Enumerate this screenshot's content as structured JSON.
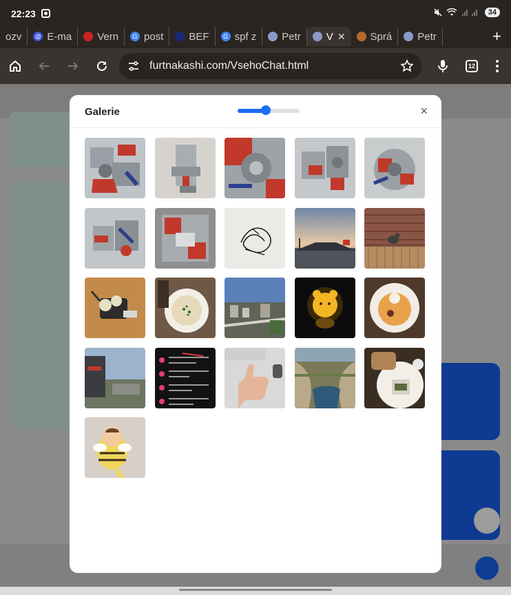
{
  "status": {
    "time": "22:23",
    "battery": "34"
  },
  "tabs": [
    {
      "label": "ozv",
      "fav": "",
      "color": "#555"
    },
    {
      "label": "E-ma",
      "fav": "@",
      "color": "#3b57d6"
    },
    {
      "label": "Vern",
      "fav": "",
      "color": "#c22"
    },
    {
      "label": "post",
      "fav": "G",
      "color": "#4285f4"
    },
    {
      "label": "BEF",
      "fav": "",
      "color": "#1a2a7a"
    },
    {
      "label": "spf z",
      "fav": "G",
      "color": "#4285f4"
    },
    {
      "label": "Petr",
      "fav": "",
      "color": "#8a9ac8"
    },
    {
      "label": "V",
      "fav": "",
      "color": "#8a9ac8"
    },
    {
      "label": "Sprá",
      "fav": "",
      "color": "#b56a2a"
    },
    {
      "label": "Petr",
      "fav": "",
      "color": "#8a9ac8"
    }
  ],
  "toolbar": {
    "url": "furtnakashi.com/VsehoChat.html",
    "tab_count": "12"
  },
  "gallery": {
    "title": "Galerie",
    "zoom_value": 0.45,
    "close_label": "×",
    "thumbnails": [
      "engine-cutaway-1",
      "engine-cutaway-2",
      "engine-cutaway-3",
      "engine-cutaway-4",
      "engine-cutaway-5",
      "engine-cutaway-6",
      "engine-cutaway-7",
      "sketch-drawing",
      "road-sunset",
      "bird-on-roof",
      "mechanical-part",
      "soup-bowl",
      "city-aerial",
      "glowing-bear-lamp",
      "dessert-plate",
      "building-sign",
      "app-screenshot",
      "thumbs-up",
      "quarry-lake",
      "bread-plate",
      "bee-figure"
    ]
  },
  "colors": {
    "accent": "#1a6ef5",
    "modal_bg": "#ffffff"
  }
}
